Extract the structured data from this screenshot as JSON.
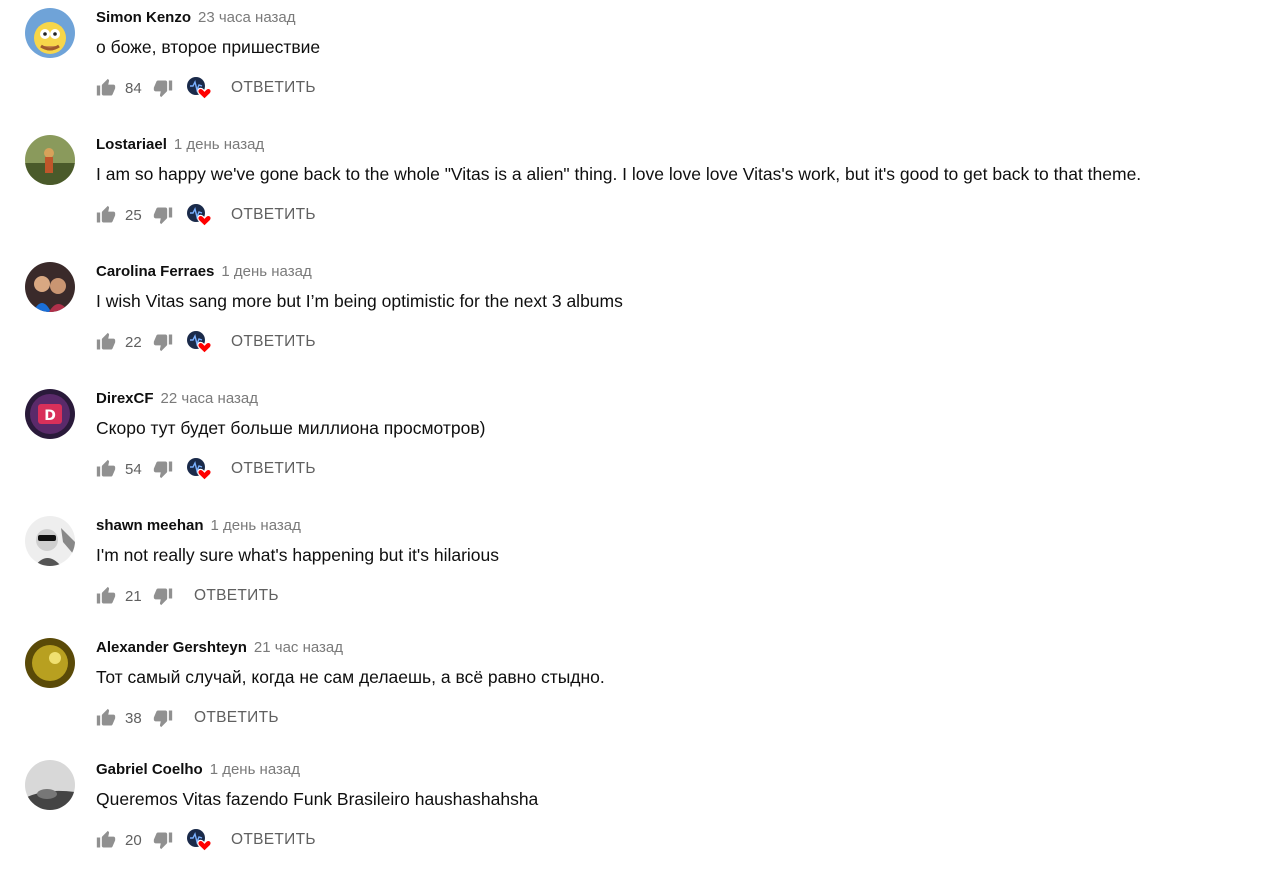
{
  "comments": [
    {
      "author": "Simon Kenzo",
      "time": "23 часа назад",
      "text": "о боже, второе пришествие",
      "likes": "84",
      "hearted": true,
      "reply_label": "ОТВЕТИТЬ"
    },
    {
      "author": "Lostariael",
      "time": "1 день назад",
      "text": "I am so happy we've gone back to the whole \"Vitas is a alien\" thing. I love love love Vitas's work, but it's good to get back to that theme.",
      "likes": "25",
      "hearted": true,
      "reply_label": "ОТВЕТИТЬ"
    },
    {
      "author": "Carolina Ferraes",
      "time": "1 день назад",
      "text": "I wish Vitas sang more but I’m being optimistic for the next 3 albums",
      "likes": "22",
      "hearted": true,
      "reply_label": "ОТВЕТИТЬ"
    },
    {
      "author": "DirexCF",
      "time": "22 часа назад",
      "text": "Скоро тут будет больше миллиона просмотров)",
      "likes": "54",
      "hearted": true,
      "reply_label": "ОТВЕТИТЬ"
    },
    {
      "author": "shawn meehan",
      "time": "1 день назад",
      "text": "I'm not really sure what's happening but it's hilarious",
      "likes": "21",
      "hearted": false,
      "reply_label": "ОТВЕТИТЬ"
    },
    {
      "author": "Alexander Gershteyn",
      "time": "21 час назад",
      "text": "Тот самый случай, когда не сам делаешь, а всё равно стыдно.",
      "likes": "38",
      "hearted": false,
      "reply_label": "ОТВЕТИТЬ"
    },
    {
      "author": "Gabriel Coelho",
      "time": "1 день назад",
      "text": "Queremos Vitas fazendo Funk Brasileiro haushashahsha",
      "likes": "20",
      "hearted": true,
      "reply_label": "ОТВЕТИТЬ"
    }
  ],
  "icons": {
    "like": "thumb-up-icon",
    "dislike": "thumb-down-icon",
    "creator_heart": "creator-heart-icon"
  },
  "colors": {
    "icon_gray": "#909090",
    "heart_red": "#ff0000",
    "creator_avatar": "#1a2a4a"
  }
}
